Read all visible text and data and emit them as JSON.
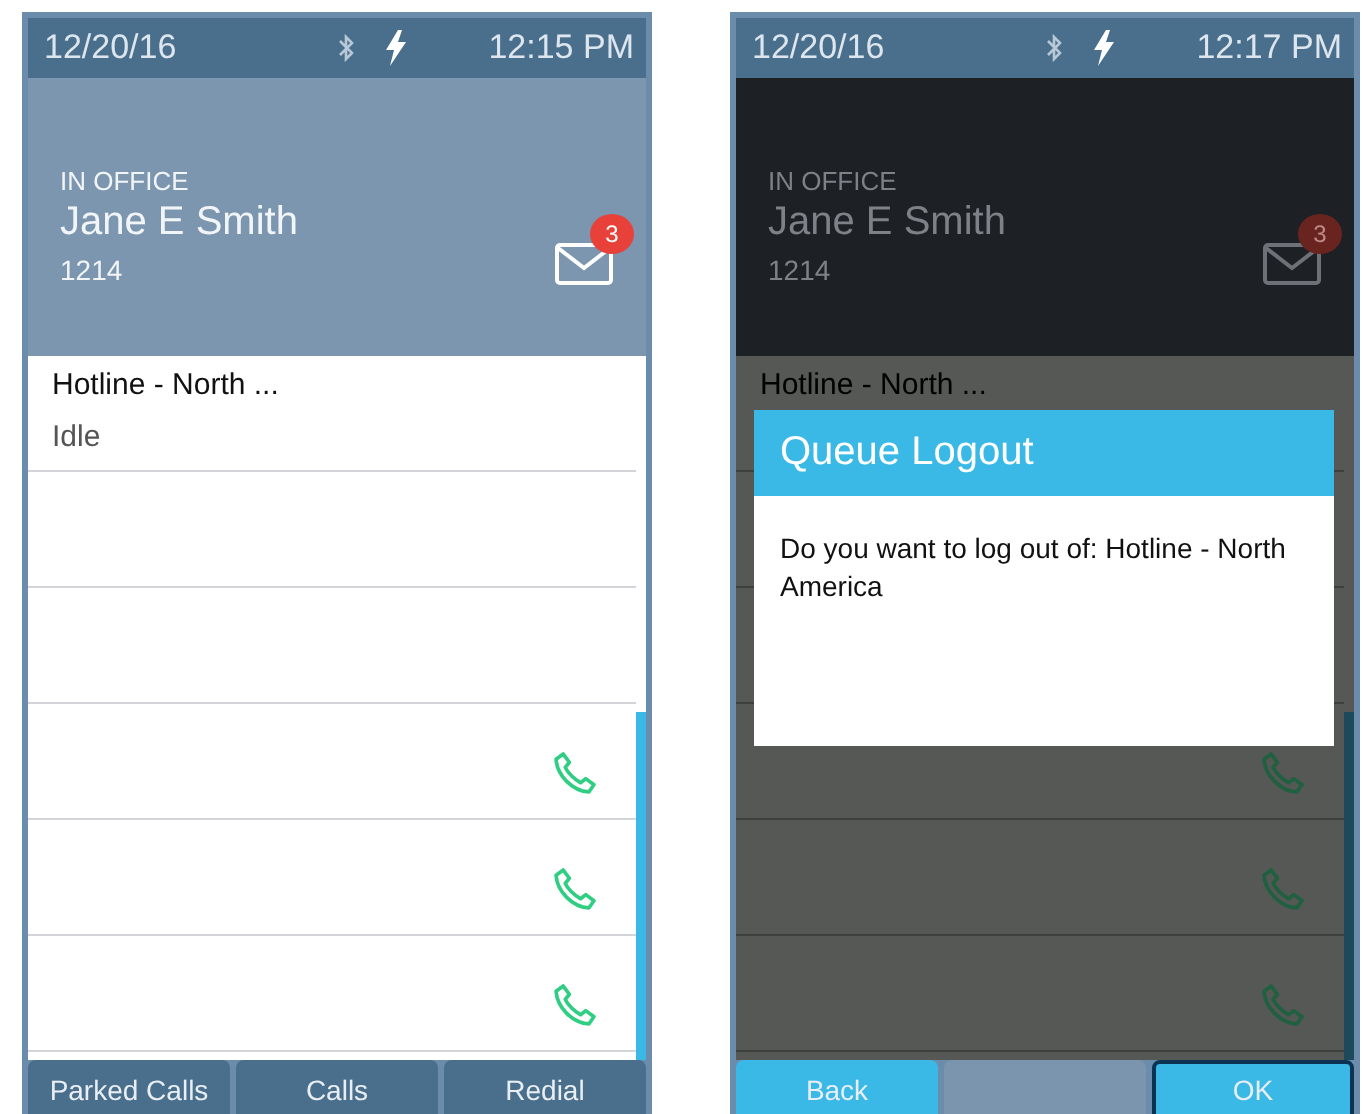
{
  "screens": [
    {
      "status_bar": {
        "date": "12/20/16",
        "time": "12:15 PM"
      },
      "header": {
        "presence": "IN OFFICE",
        "name": "Jane E Smith",
        "extension": "1214",
        "message_badge": "3"
      },
      "lines": [
        {
          "kind": "queue",
          "title": "Hotline - North ...",
          "status": "Idle"
        },
        {
          "kind": "empty"
        },
        {
          "kind": "empty"
        },
        {
          "kind": "call"
        },
        {
          "kind": "call"
        },
        {
          "kind": "call"
        }
      ],
      "softkeys": [
        {
          "label": "Parked Calls",
          "highlighted": false,
          "focused": false
        },
        {
          "label": "Calls",
          "highlighted": false,
          "focused": false
        },
        {
          "label": "Redial",
          "highlighted": false,
          "focused": false
        }
      ]
    },
    {
      "status_bar": {
        "date": "12/20/16",
        "time": "12:17 PM"
      },
      "header": {
        "presence": "IN OFFICE",
        "name": "Jane E Smith",
        "extension": "1214",
        "message_badge": "3"
      },
      "lines": [
        {
          "kind": "queue",
          "title": "Hotline - North ..."
        },
        {
          "kind": "empty"
        },
        {
          "kind": "empty"
        },
        {
          "kind": "call"
        },
        {
          "kind": "call"
        },
        {
          "kind": "call"
        }
      ],
      "dialog": {
        "title": "Queue Logout",
        "message": "Do you want to log out of: Hotline - North America"
      },
      "softkeys": [
        {
          "label": "Back",
          "highlighted": true,
          "focused": false
        },
        {
          "highlighted": false,
          "focused": false
        },
        {
          "label": "OK",
          "highlighted": true,
          "focused": true
        }
      ]
    }
  ]
}
